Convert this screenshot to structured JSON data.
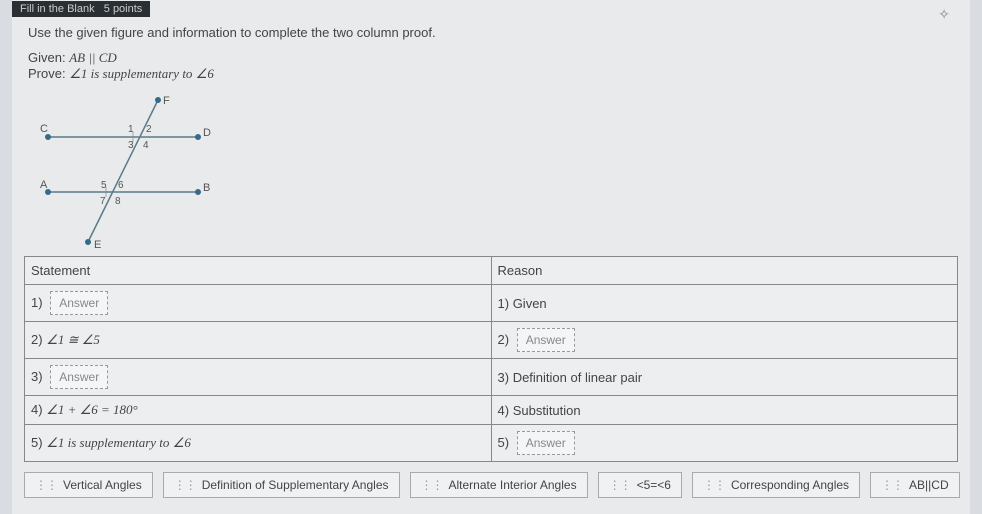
{
  "header": {
    "type_label": "Fill in the Blank",
    "points_label": "5 points"
  },
  "prompt": "Use the given figure and information to complete the two column proof.",
  "given_label": "Given:",
  "given_text": "AB || CD",
  "prove_label": "Prove:",
  "prove_text": "∠1 is supplementary to ∠6",
  "figure": {
    "points": {
      "F": "F",
      "C": "C",
      "D": "D",
      "A": "A",
      "B": "B",
      "E": "E"
    },
    "angles": {
      "a1": "1",
      "a2": "2",
      "a3": "3",
      "a4": "4",
      "a5": "5",
      "a6": "6",
      "a7": "7",
      "a8": "8"
    }
  },
  "table": {
    "stmt_header": "Statement",
    "reason_header": "Reason",
    "rows": [
      {
        "snum": "1)",
        "stmt_answer": "Answer",
        "rnum": "1)",
        "reason": "Given"
      },
      {
        "snum": "2)",
        "stmt_html": "∠1 ≅ ∠5",
        "rnum": "2)",
        "reason_answer": "Answer"
      },
      {
        "snum": "3)",
        "stmt_answer": "Answer",
        "rnum": "3)",
        "reason": "Definition of linear pair"
      },
      {
        "snum": "4)",
        "stmt_html": "∠1 + ∠6 = 180°",
        "rnum": "4)",
        "reason": "Substitution"
      },
      {
        "snum": "5)",
        "stmt_html": "∠1 is supplementary to ∠6",
        "rnum": "5)",
        "reason_answer": "Answer"
      }
    ]
  },
  "bank": [
    "Vertical Angles",
    "Definition of Supplementary Angles",
    "Alternate Interior Angles",
    "<5=<6",
    "Corresponding Angles",
    "AB||CD"
  ]
}
